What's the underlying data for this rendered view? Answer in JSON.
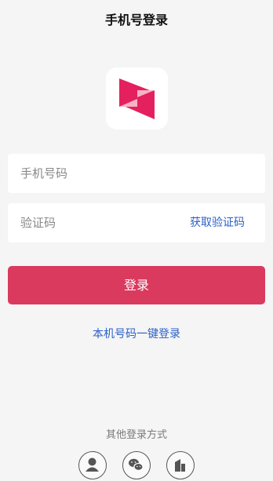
{
  "header": {
    "title": "手机号登录"
  },
  "brand": {
    "logo_icon": "bowtie-play-logo-icon",
    "primary_color": "#e5205f",
    "secondary_color": "#f5a3b8"
  },
  "form": {
    "phone_placeholder": "手机号码",
    "code_placeholder": "验证码",
    "get_code_label": "获取验证码",
    "login_label": "登录",
    "login_color": "#da3a5e"
  },
  "links": {
    "oneclick_label": "本机号码一键登录",
    "link_color": "#2b60c8"
  },
  "other_login": {
    "label": "其他登录方式",
    "options": [
      "person-icon",
      "wechat-icon",
      "building-icon"
    ]
  }
}
